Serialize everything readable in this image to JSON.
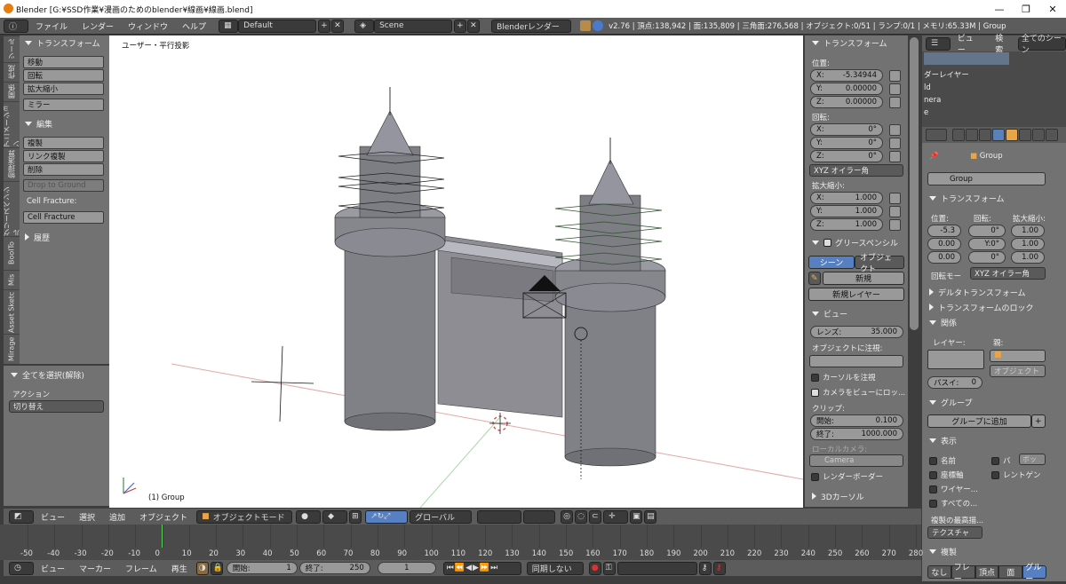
{
  "window": {
    "title": "Blender [G:¥SSD作業¥漫画のためのblender¥線画¥線画.blend]",
    "minimize": "—",
    "maximize": "❐",
    "close": "✕"
  },
  "topbar": {
    "menus": [
      "ファイル",
      "レンダー",
      "ウィンドウ",
      "ヘルプ"
    ],
    "layout": "Default",
    "scene": "Scene",
    "engine": "Blenderレンダー",
    "stats": "v2.76 | 頂点:138,942 | 面:135,809 | 三角面:276,568 | オブジェクト:0/51 | ランプ:0/1 | メモリ:65.33M | Group"
  },
  "left": {
    "tabs": [
      "ツール",
      "作成",
      "関係",
      "アニメーション",
      "物理演算",
      "グリースペンシル",
      "BoolTo",
      "Mis",
      "Asset Sketc",
      "Mirage"
    ],
    "transform_header": "トランスフォーム",
    "move": "移動",
    "rotate": "回転",
    "scale": "拡大縮小",
    "mirror": "ミラー",
    "edit_header": "編集",
    "duplicate": "複製",
    "link_duplicate": "リンク複製",
    "delete": "削除",
    "drop_to_ground": "Drop to Ground",
    "cell_fracture_label": "Cell Fracture:",
    "cell_fracture": "Cell Fracture",
    "history_header": "履歴",
    "op_header": "全てを選択(解除)",
    "action_label": "アクション",
    "action_value": "切り替え"
  },
  "viewport": {
    "view_label": "ユーザー・平行投影",
    "object_label": "(1) Group"
  },
  "npanel": {
    "transform_header": "トランスフォーム",
    "location_label": "位置:",
    "loc": [
      {
        "a": "X:",
        "v": "-5.34944"
      },
      {
        "a": "Y:",
        "v": "0.00000"
      },
      {
        "a": "Z:",
        "v": "0.00000"
      }
    ],
    "rotation_label": "回転:",
    "rot": [
      {
        "a": "X:",
        "v": "0°"
      },
      {
        "a": "Y:",
        "v": "0°"
      },
      {
        "a": "Z:",
        "v": "0°"
      }
    ],
    "rot_mode": "XYZ オイラー角",
    "scale_label": "拡大縮小:",
    "scl": [
      {
        "a": "X:",
        "v": "1.000"
      },
      {
        "a": "Y:",
        "v": "1.000"
      },
      {
        "a": "Z:",
        "v": "1.000"
      }
    ],
    "grease_header": "グリースペンシル",
    "gp_scene": "シーン",
    "gp_object": "オブジェクト",
    "gp_new": "新規",
    "gp_new_layer": "新規レイヤー",
    "view_header": "ビュー",
    "lens_label": "レンズ:",
    "lens_value": "35.000",
    "lock_obj_label": "オブジェクトに注視:",
    "lock_cursor": "カーソルを注視",
    "lock_cam": "カメラをビューにロッ...",
    "clip_label": "クリップ:",
    "clip_start_label": "開始:",
    "clip_start": "0.100",
    "clip_end_label": "終了:",
    "clip_end": "1000.000",
    "local_cam_label": "ローカルカメラ:",
    "camera": "Camera",
    "render_border": "レンダーボーダー",
    "cursor_header": "3Dカーソル"
  },
  "outliner": {
    "view": "ビュー",
    "search": "検索",
    "scenes": "全てのシーン",
    "rows": [
      "ダーレイヤー",
      "ld",
      "nera",
      "e"
    ]
  },
  "props": {
    "breadcrumb": "Group",
    "name": "Group",
    "transform_header": "トランスフォーム",
    "loc_label": "位置:",
    "rot_label": "回転:",
    "scale_label": "拡大縮小:",
    "loc": [
      "-5.3",
      "0.00",
      "0.00"
    ],
    "rot": [
      "0°",
      "Y:0°",
      "0°"
    ],
    "scl": [
      "1.00",
      "1.00",
      "1.00"
    ],
    "rot_mode_label": "回転モー",
    "rot_mode": "XYZ オイラー角",
    "delta_header": "デルタトランスフォーム",
    "lock_header": "トランスフォームのロック",
    "relations_header": "関係",
    "layer_label": "レイヤー:",
    "parent_label": "親:",
    "object_label": "オブジェクト",
    "pass_label": "パスイ:",
    "pass_value": "0",
    "group_header": "グループ",
    "add_group": "グループに追加",
    "display_header": "表示",
    "name_chk": "名前",
    "bounds_chk": "バ",
    "bounds_sel": "ボッ",
    "axis_chk": "座標軸",
    "xray_chk": "レントゲン",
    "wire_chk": "ワイヤー...",
    "all_chk": "すべての...",
    "max_draw_label": "複製の最高描...",
    "max_draw": "テクスチャ",
    "dup_header": "複製",
    "dup_tabs": [
      "なし",
      "フレー",
      "頂点",
      "面",
      "グルー"
    ]
  },
  "header3d": {
    "view": "ビュー",
    "select": "選択",
    "add": "追加",
    "object": "オブジェクト",
    "mode": "オブジェクトモード",
    "orientation": "グローバル"
  },
  "timeline": {
    "ticks": [
      "-50",
      "-40",
      "-30",
      "-20",
      "-10",
      "0",
      "10",
      "20",
      "30",
      "40",
      "50",
      "60",
      "70",
      "80",
      "90",
      "100",
      "110",
      "120",
      "130",
      "140",
      "150",
      "160",
      "170",
      "180",
      "190",
      "200",
      "210",
      "220",
      "230",
      "240",
      "250",
      "260",
      "270",
      "280"
    ],
    "view": "ビュー",
    "marker": "マーカー",
    "frame": "フレーム",
    "playback": "再生",
    "start_label": "開始:",
    "start": "1",
    "end_label": "終了:",
    "end": "250",
    "current": "1",
    "sync": "同期しない"
  }
}
